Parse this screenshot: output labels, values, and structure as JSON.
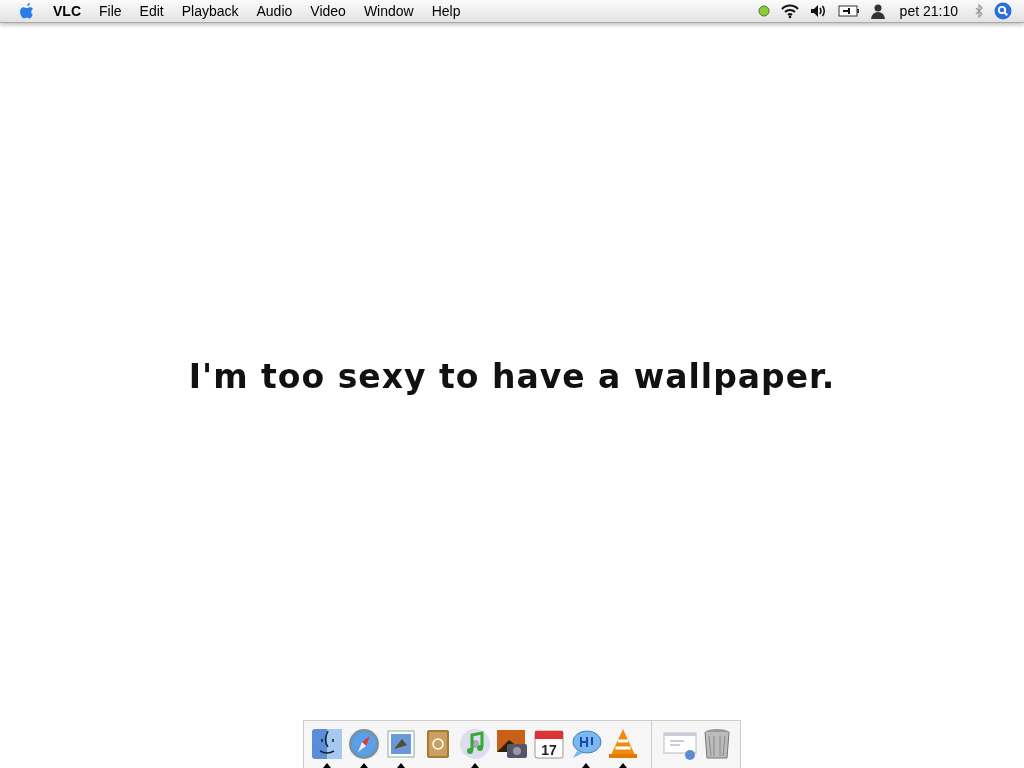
{
  "menu_bar": {
    "app_name": "VLC",
    "menus": [
      "File",
      "Edit",
      "Playback",
      "Audio",
      "Video",
      "Window",
      "Help"
    ],
    "clock": "pet 21:10"
  },
  "desktop": {
    "message": "I'm too sexy to have a wallpaper."
  },
  "dock": {
    "calendar_day": "17",
    "apps": [
      {
        "running": true
      },
      {
        "running": true
      },
      {
        "running": true
      },
      {
        "running": false
      },
      {
        "running": true
      },
      {
        "running": false
      },
      {
        "running": false
      },
      {
        "running": true
      },
      {
        "running": true
      }
    ]
  }
}
